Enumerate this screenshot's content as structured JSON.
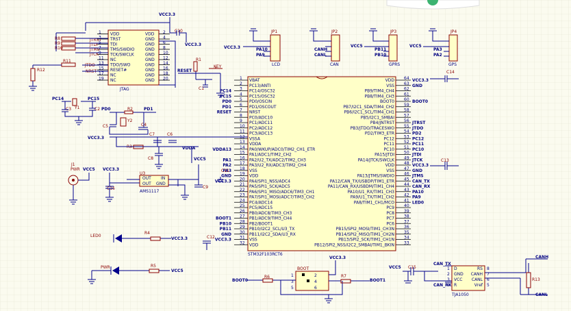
{
  "power": {
    "vcc33": "VCC3.3",
    "vcc5": "VCC5",
    "gnd": "GND",
    "vdda": "VDDA"
  },
  "jtag": {
    "name": "JTAG",
    "left_pins": [
      "VDD",
      "TRST",
      "TDI",
      "TMS/SWDIO",
      "TCK/SWCLK",
      "NC",
      "TDO/SWO",
      "RESET#",
      "NC",
      "NC"
    ],
    "right_pins": [
      "VDD",
      "GND",
      "GND",
      "GND",
      "GND",
      "GND",
      "GND",
      "GND",
      "GND",
      "GND"
    ],
    "left_nums": [
      "1",
      "3",
      "5",
      "7",
      "9",
      "11",
      "13",
      "15",
      "17",
      "19"
    ],
    "right_nums": [
      "2",
      "4",
      "6",
      "8",
      "10",
      "12",
      "14",
      "16",
      "18",
      "20"
    ],
    "nets": [
      "JTRST",
      "JTDI",
      "JTMS",
      "JTCK",
      "JTDO",
      "NRST"
    ],
    "resistors": [
      "R8",
      "R9",
      "R10",
      "R11",
      "R12"
    ]
  },
  "reset": {
    "cap": "C10",
    "res": "R1",
    "key": "KEY",
    "cap2": "C1",
    "net": "RESET"
  },
  "headers": [
    {
      "ref": "JP1",
      "label": "LCD",
      "nets": [
        "VCC3.3",
        "PA10",
        "PA9"
      ]
    },
    {
      "ref": "JP2",
      "label": "CAN",
      "nets": [
        "CANH",
        "CANL"
      ]
    },
    {
      "ref": "JP3",
      "label": "GPRS",
      "nets": [
        "VCC5",
        "PB11",
        "PB10"
      ]
    },
    {
      "ref": "JP4",
      "label": "GPS",
      "nets": [
        "VCC5",
        "PA3",
        "PA2"
      ]
    }
  ],
  "mcu": {
    "name": "STM32F103RCT6",
    "left_pins": [
      [
        "1",
        "VBAT"
      ],
      [
        "2",
        "PC13/ANTI"
      ],
      [
        "3",
        "PC14/OSC32"
      ],
      [
        "4",
        "PC15/OSC32"
      ],
      [
        "5",
        "PD0/OSCIN"
      ],
      [
        "6",
        "PD1/OSCOUT"
      ],
      [
        "7",
        "NRST"
      ],
      [
        "8",
        "PC0/ADC10"
      ],
      [
        "9",
        "PC1/ADC11"
      ],
      [
        "10",
        "PC2/ADC12"
      ],
      [
        "11",
        "PC3/ADC13"
      ],
      [
        "12",
        "VSSA"
      ],
      [
        "13",
        "VDDA"
      ],
      [
        "14",
        "PA0/WKUP/ADC0/TIM2_CH1_ETR"
      ],
      [
        "15",
        "PA1/ADC1/TIM2_CH2"
      ],
      [
        "16",
        "PA2/U2_TX/ADC2/TIM2_CH3"
      ],
      [
        "17",
        "PA3/U2_RX/ADC3/TIM2_CH4"
      ],
      [
        "18",
        "VSS"
      ],
      [
        "19",
        "VDD"
      ],
      [
        "20",
        "PA4/SPI1_NSS/ADC4"
      ],
      [
        "21",
        "PA5/SPI1_SCK/ADC5"
      ],
      [
        "22",
        "PA6/SPI1_MISO/ADC6/TIM3_CH1"
      ],
      [
        "23",
        "PA7/SPI1_MOSI/ADC7/TIM3_CH2"
      ],
      [
        "24",
        "PC4/ADC14"
      ],
      [
        "25",
        "PC5/ADC15"
      ],
      [
        "26",
        "PB0/ADC8/TIM3_CH3"
      ],
      [
        "27",
        "PB1/ADC9/TIM3_CH4"
      ],
      [
        "28",
        "PB2/BOOT1"
      ],
      [
        "29",
        "PB10/I2C2_SCL/U3_TX"
      ],
      [
        "30",
        "PB11/I2C2_SDA/U3_RX"
      ],
      [
        "31",
        "VSS"
      ],
      [
        "32",
        "VDD"
      ]
    ],
    "right_pins": [
      [
        "64",
        "VDD"
      ],
      [
        "63",
        "VSS"
      ],
      [
        "62",
        "PB9/TIM4_CH4"
      ],
      [
        "61",
        "PB8/TIM4_CH3"
      ],
      [
        "60",
        "BOOT0"
      ],
      [
        "59",
        "PB7/I2C1_SDA/TIM4_CH2"
      ],
      [
        "58",
        "PB6/I2C1_SCL/TIM4_CH1"
      ],
      [
        "57",
        "PB5/I2C1_SMBAI"
      ],
      [
        "56",
        "PB4/JNTRST"
      ],
      [
        "55",
        "PB3/JTDO/TRACESWO"
      ],
      [
        "54",
        "PD2/TIM3_ETR"
      ],
      [
        "53",
        "PC12"
      ],
      [
        "52",
        "PC11"
      ],
      [
        "51",
        "PC10"
      ],
      [
        "50",
        "PA15/JTDI"
      ],
      [
        "49",
        "PA14/JTCK/SWCLK"
      ],
      [
        "48",
        "VDD"
      ],
      [
        "47",
        "VSS"
      ],
      [
        "46",
        "PA13/JTMS/SWDIO"
      ],
      [
        "45",
        "PA12/CAN_TX/USBDP/TIM1_ETR"
      ],
      [
        "44",
        "PA11/CAN_RX/USBDM/TIM1_CH4"
      ],
      [
        "43",
        "PA10/U1_RX/TIM1_CH3"
      ],
      [
        "42",
        "PA9/U1_TX/TIM1_CH2"
      ],
      [
        "41",
        "PA8/TIM1_CH1/MCO"
      ],
      [
        "40",
        "PC9"
      ],
      [
        "39",
        "PC8"
      ],
      [
        "38",
        "PC7"
      ],
      [
        "37",
        "PC6"
      ],
      [
        "36",
        "PB15/SPI2_MOSI/TIM1_CH3N"
      ],
      [
        "35",
        "PB14/SPI2_MISO/TIM1_CH2N"
      ],
      [
        "34",
        "PB13/SPI2_SCK/TIM1_CH1N"
      ],
      [
        "33",
        "PB12/SPI2_NSS/I2C2_SMBAI/TIM1_BKIN"
      ]
    ],
    "left_nets": [
      "",
      "PC14",
      "PC15",
      "PD0",
      "PD1",
      "RESET",
      "",
      "",
      "",
      "",
      "",
      "",
      "VDDA13",
      "",
      "PA1",
      "PA2",
      "PA3",
      "GND",
      "VCC3.3",
      "",
      "",
      "",
      "",
      "",
      "",
      "BOOT1",
      "PB10",
      "PB11",
      "GND",
      "VCC3.3"
    ],
    "right_nets": [
      "VCC3.3",
      "GND",
      "",
      "",
      "BOOT0",
      "",
      "",
      "",
      "JTRST",
      "JTDO",
      "PD2",
      "PC12",
      "PC11",
      "PC10",
      "JTDI",
      "JTCK",
      "VCC3.3",
      "GND",
      "JTMS",
      "CAN_TX",
      "CAN_RX",
      "PA10",
      "PA9",
      "LED0"
    ]
  },
  "osc": {
    "x1": "Y1",
    "x2": "Y2",
    "caps": [
      "C2",
      "C3",
      "C5",
      "C4"
    ],
    "res": [
      "R2"
    ],
    "nets": [
      "PC14",
      "PC15",
      "PD0",
      "PD1"
    ]
  },
  "adc_filter": {
    "caps": [
      "C7",
      "C6",
      "C8"
    ],
    "res": "R3",
    "net": "VDDA"
  },
  "power_supply": {
    "jack": "J1",
    "jack_label": "PWR",
    "reg": "U3",
    "reg_name": "AMS1117",
    "reg_pins": [
      "OUT",
      "IN",
      "OUT",
      "GND"
    ],
    "caps": [
      "C16",
      "C9"
    ]
  },
  "decoupling": {
    "c11": "C11",
    "c12": "C12",
    "c13": "C13",
    "c14": "C14"
  },
  "leds": [
    {
      "ref": "LED0",
      "res": "R4",
      "net": "VCC3.3"
    },
    {
      "ref": "PWR",
      "res": "R5",
      "net": "VCC5"
    }
  ],
  "boot": {
    "ref": "BOOT",
    "res_left": "R6",
    "res_right": "R7",
    "left_net": "BOOT0",
    "right_net": "BOOT1",
    "pins": [
      "1",
      "2",
      "3",
      "4",
      "5",
      "6"
    ]
  },
  "can_xcvr": {
    "ref": "TJA1050",
    "cap": "C15",
    "res": "R13",
    "pins_left": [
      "D",
      "GND",
      "VCC",
      "R"
    ],
    "pins_right": [
      "RS",
      "CANH",
      "CANL",
      "Vref"
    ],
    "nums_left": [
      "1",
      "2",
      "3",
      "4"
    ],
    "nums_right": [
      "8",
      "7",
      "6",
      "5"
    ],
    "nets": [
      "CAN_TX",
      "CAN_RX",
      "CANH",
      "CANL"
    ]
  }
}
